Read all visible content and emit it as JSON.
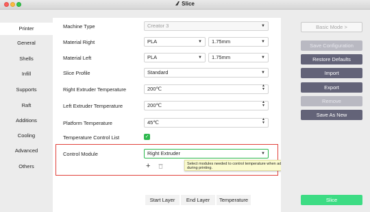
{
  "window": {
    "title": "Slice"
  },
  "sidebar": {
    "items": [
      {
        "label": "Printer",
        "active": true
      },
      {
        "label": "General",
        "active": false
      },
      {
        "label": "Shells",
        "active": false
      },
      {
        "label": "Infill",
        "active": false
      },
      {
        "label": "Supports",
        "active": false
      },
      {
        "label": "Raft",
        "active": false
      },
      {
        "label": "Additions",
        "active": false
      },
      {
        "label": "Cooling",
        "active": false
      },
      {
        "label": "Advanced",
        "active": false
      },
      {
        "label": "Others",
        "active": false
      }
    ]
  },
  "form": {
    "machine_type": {
      "label": "Machine Type",
      "value": "Creator 3"
    },
    "material_right": {
      "label": "Material Right",
      "material": "PLA",
      "diameter": "1.75mm"
    },
    "material_left": {
      "label": "Material Left",
      "material": "PLA",
      "diameter": "1.75mm"
    },
    "slice_profile": {
      "label": "Slice Profile",
      "value": "Standard"
    },
    "right_temp": {
      "label": "Right Extruder Temperature",
      "value": "200℃"
    },
    "left_temp": {
      "label": "Left Extruder Temperature",
      "value": "200℃"
    },
    "platform_temp": {
      "label": "Platform Temperature",
      "value": "45℃"
    },
    "temp_control_list": {
      "label": "Temperature Control List",
      "checked": true
    },
    "control_module": {
      "label": "Control Module",
      "value": "Right Extruder"
    },
    "tooltip": "Select modules needed to control temperature when added, it will get work during printing.",
    "table_headers": [
      "Start Layer",
      "End Layer",
      "Temperature"
    ]
  },
  "actions": {
    "mode_button": "Basic Mode >",
    "save_configuration": "Save Configuration",
    "restore_defaults": "Restore Defaults",
    "import": "Import",
    "export": "Export",
    "remove": "Remove",
    "save_as_new": "Save As New",
    "slice": "Slice"
  },
  "colors": {
    "accent_green": "#2db84d",
    "slice_green": "#3ddc84",
    "button_dark": "#636378",
    "highlight_red": "#e0413a",
    "tooltip_bg": "#fbfbcf"
  }
}
